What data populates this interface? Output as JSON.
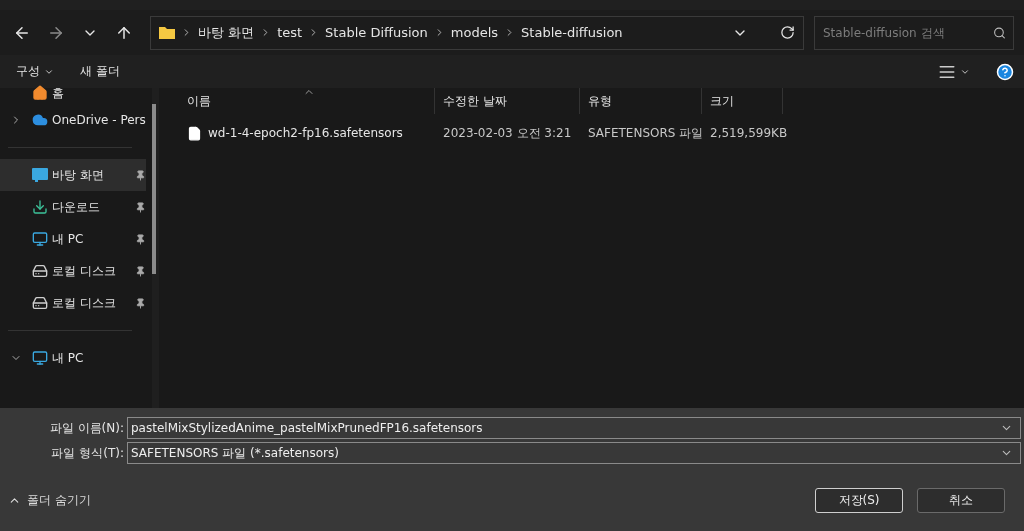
{
  "navigation": {
    "breadcrumbs": [
      "바탕 화면",
      "test",
      "Stable Diffusion",
      "models",
      "Stable-diffusion"
    ],
    "search": {
      "placeholder": "Stable-diffusion 검색"
    }
  },
  "toolbar": {
    "organize": "구성",
    "new_folder": "새 폴더"
  },
  "sidebar": {
    "items": [
      {
        "kind": "home",
        "label": "홈",
        "selected": false,
        "pinned": false
      },
      {
        "kind": "cloud",
        "label": "OneDrive - Pers",
        "selected": false,
        "pinned": false,
        "expanded": false
      },
      {
        "kind": "divider"
      },
      {
        "kind": "desktop",
        "label": "바탕 화면",
        "selected": true,
        "pinned": true
      },
      {
        "kind": "download",
        "label": "다운로드",
        "selected": false,
        "pinned": true
      },
      {
        "kind": "pc",
        "label": "내 PC",
        "selected": false,
        "pinned": true
      },
      {
        "kind": "windisk",
        "label": "로컬 디스크",
        "selected": false,
        "pinned": true
      },
      {
        "kind": "disk",
        "label": "로컬 디스크",
        "selected": false,
        "pinned": true
      },
      {
        "kind": "divider"
      },
      {
        "kind": "pc",
        "label": "내 PC",
        "selected": false,
        "pinned": false,
        "expanded": true
      }
    ]
  },
  "table": {
    "columns": [
      "이름",
      "수정한 날짜",
      "유형",
      "크기"
    ],
    "rows": [
      {
        "name": "wd-1-4-epoch2-fp16.safetensors",
        "modified": "2023-02-03 오전 3:21",
        "type": "SAFETENSORS 파일",
        "size": "2,519,599KB",
        "selected": false
      }
    ]
  },
  "form": {
    "file_name": {
      "label": "파일 이름(N):",
      "value": "pastelMixStylizedAnime_pastelMixPrunedFP16.safetensors"
    },
    "file_type": {
      "label": "파일 형식(T):",
      "value": "SAFETENSORS 파일 (*.safetensors)"
    }
  },
  "footer": {
    "hide_folders": "폴더 숨기기",
    "buttons": [
      "저장(S)",
      "취소"
    ]
  }
}
